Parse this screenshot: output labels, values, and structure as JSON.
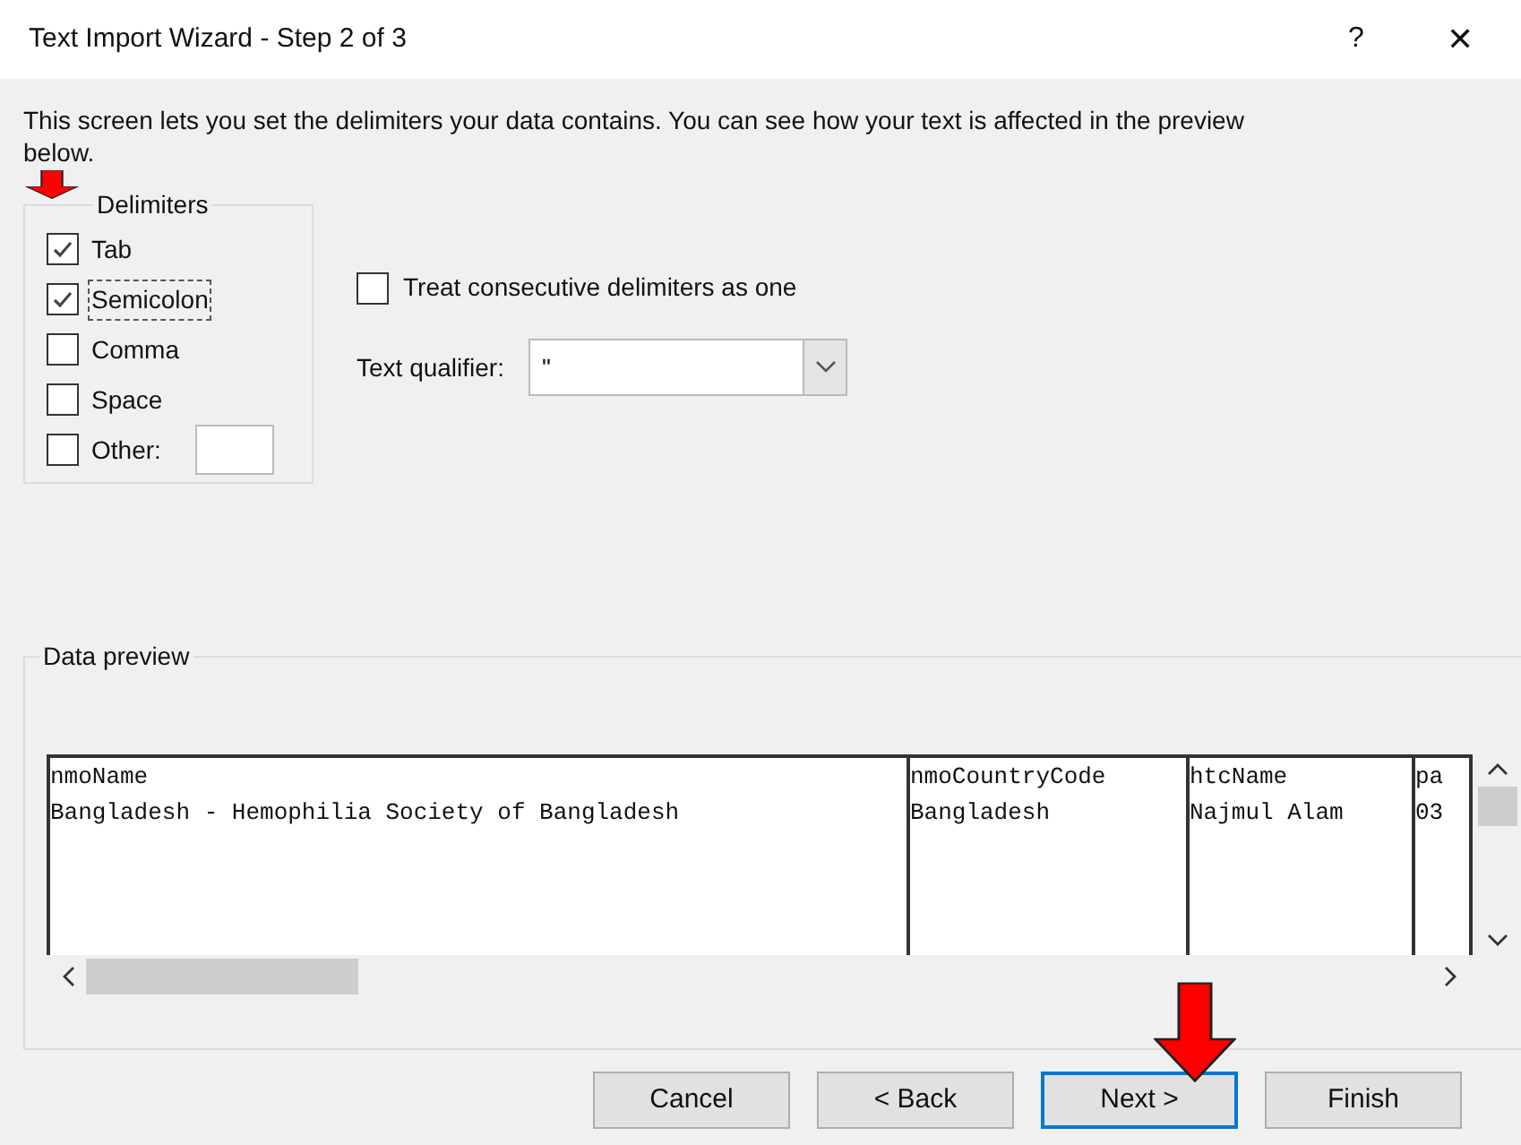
{
  "window": {
    "title": "Text Import Wizard - Step 2 of 3",
    "help": "?",
    "close": "✕"
  },
  "description": "This screen lets you set the delimiters your data contains.  You can see how your text is affected in the preview below.",
  "delimiters": {
    "legend": "Delimiters",
    "items": [
      {
        "label": "Tab",
        "checked": true,
        "focused": false
      },
      {
        "label": "Semicolon",
        "checked": true,
        "focused": true
      },
      {
        "label": "Comma",
        "checked": false,
        "focused": false
      },
      {
        "label": "Space",
        "checked": false,
        "focused": false
      },
      {
        "label": "Other:",
        "checked": false,
        "focused": false,
        "kind": "other"
      }
    ]
  },
  "treat_consecutive": {
    "label": "Treat consecutive delimiters as one",
    "checked": false
  },
  "text_qualifier": {
    "label": "Text qualifier:",
    "value": "\""
  },
  "data_preview": {
    "legend": "Data preview",
    "columns": [
      {
        "cells": [
          "nmoName",
          "Bangladesh - Hemophilia Society of Bangladesh"
        ]
      },
      {
        "cells": [
          "nmoCountryCode",
          "Bangladesh"
        ]
      },
      {
        "cells": [
          "htcName",
          "Najmul Alam"
        ]
      },
      {
        "cells": [
          "pa",
          "03"
        ]
      }
    ]
  },
  "buttons": [
    {
      "label": "Cancel",
      "default": false
    },
    {
      "label": "< Back",
      "default": false
    },
    {
      "label": "Next >",
      "default": true
    },
    {
      "label": "Finish",
      "default": false
    }
  ]
}
